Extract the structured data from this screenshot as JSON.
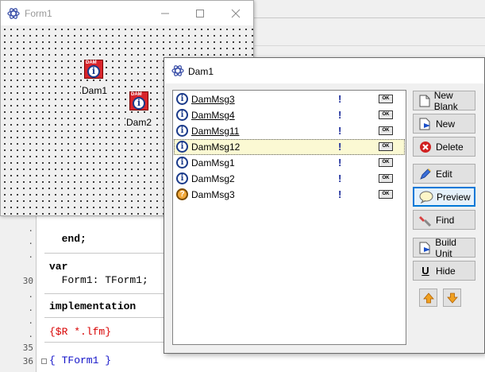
{
  "editor": {
    "lines": [
      {
        "num": ".",
        "text": "  end;",
        "kind": "kw"
      },
      {
        "num": ".",
        "text": "var",
        "kind": "kw"
      },
      {
        "num": "30",
        "text": "  Form1: TForm1;",
        "kind": "normal"
      },
      {
        "num": ".",
        "text": "implementation",
        "kind": "kw"
      },
      {
        "num": ".",
        "text": "{$R *.lfm}",
        "kind": "dir"
      },
      {
        "num": "35",
        "text": "",
        "kind": "normal"
      },
      {
        "num": "36",
        "text": "{ TForm1 }",
        "kind": "cmt"
      }
    ]
  },
  "form1": {
    "title": "Form1",
    "components": [
      {
        "label": "Dam1",
        "tag": "DAM"
      },
      {
        "label": "Dam2",
        "tag": "DAM"
      }
    ]
  },
  "dam1": {
    "title": "Dam1",
    "messages": [
      {
        "name": "DamMsg3",
        "underlined": true,
        "icon": "info-icon",
        "bang": "!",
        "ok": "OK",
        "selected": false
      },
      {
        "name": "DamMsg4",
        "underlined": true,
        "icon": "info-icon",
        "bang": "!",
        "ok": "OK",
        "selected": false
      },
      {
        "name": "DamMsg11",
        "underlined": true,
        "icon": "info-icon",
        "bang": "!",
        "ok": "OK",
        "selected": false
      },
      {
        "name": "DamMsg12",
        "underlined": false,
        "icon": "info-icon",
        "bang": "!",
        "ok": "OK",
        "selected": true
      },
      {
        "name": "DamMsg1",
        "underlined": false,
        "icon": "info-icon",
        "bang": "!",
        "ok": "OK",
        "selected": false
      },
      {
        "name": "DamMsg2",
        "underlined": false,
        "icon": "info-icon",
        "bang": "!",
        "ok": "OK",
        "selected": false
      },
      {
        "name": "DamMsg3",
        "underlined": false,
        "icon": "question-icon",
        "bang": "!",
        "ok": "OK",
        "selected": false
      }
    ],
    "buttons": {
      "new_blank": "New Blank",
      "new": "New",
      "delete": "Delete",
      "edit": "Edit",
      "preview": "Preview",
      "find": "Find",
      "build_unit": "Build Unit",
      "hide": "Hide",
      "hide_hotkey": "U"
    }
  },
  "colors": {
    "selection": "#fbf9d3",
    "focus_border": "#0078d7",
    "component_red": "#d8252c",
    "arrow_orange": "#f0a020"
  }
}
